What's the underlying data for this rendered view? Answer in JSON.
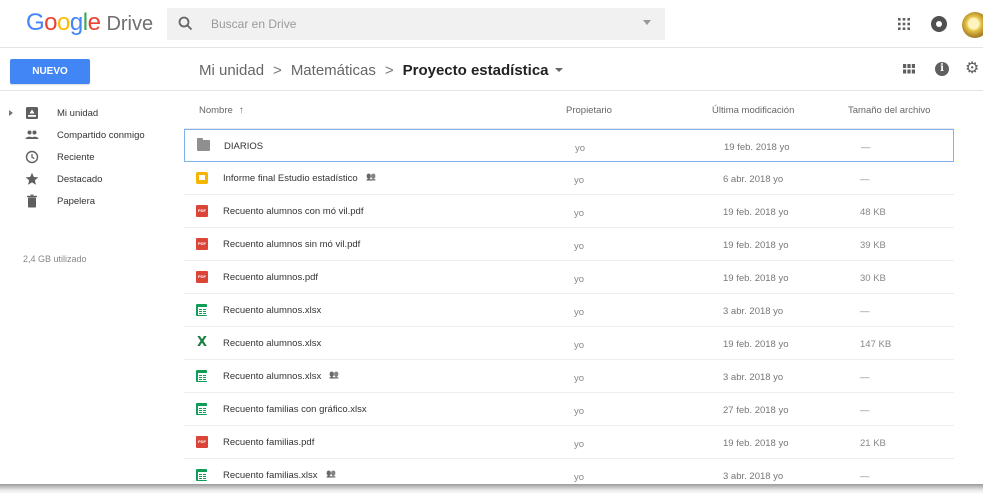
{
  "app": {
    "logo_google": "Google",
    "logo_drive": "Drive",
    "logo_colors": [
      "#4285F4",
      "#EA4335",
      "#FBBC05",
      "#4285F4",
      "#34A853",
      "#EA4335"
    ]
  },
  "search": {
    "placeholder": "Buscar en Drive",
    "value": ""
  },
  "toolbar": {
    "new_label": "NUEVO",
    "accent": "#4285f4"
  },
  "breadcrumb": {
    "items": [
      "Mi unidad",
      "Matemáticas"
    ],
    "separator": ">",
    "current": "Proyecto estadística"
  },
  "sidebar": {
    "items": [
      {
        "label": "Mi unidad",
        "icon": "drive-icon"
      },
      {
        "label": "Compartido conmigo",
        "icon": "people-icon"
      },
      {
        "label": "Reciente",
        "icon": "clock-icon"
      },
      {
        "label": "Destacado",
        "icon": "star-icon"
      },
      {
        "label": "Papelera",
        "icon": "trash-icon"
      }
    ],
    "storage": "2,4 GB utilizado"
  },
  "list": {
    "headers": {
      "name": "Nombre",
      "sort_arrow": "↑",
      "owner": "Propietario",
      "modified": "Última modificación",
      "size": "Tamaño del archivo"
    },
    "rows": [
      {
        "type": "folder",
        "name": "DIARIOS",
        "shared": false,
        "owner": "yo",
        "modified": "19 feb. 2018 yo",
        "size": "—"
      },
      {
        "type": "slides",
        "name": "Informe final Estudio estadístico",
        "shared": true,
        "owner": "yo",
        "modified": "6 abr. 2018 yo",
        "size": "—"
      },
      {
        "type": "pdf",
        "name": "Recuento alumnos con mó vil.pdf",
        "shared": false,
        "owner": "yo",
        "modified": "19 feb. 2018 yo",
        "size": "48 KB"
      },
      {
        "type": "pdf",
        "name": "Recuento alumnos sin mó vil.pdf",
        "shared": false,
        "owner": "yo",
        "modified": "19 feb. 2018 yo",
        "size": "39 KB"
      },
      {
        "type": "pdf",
        "name": "Recuento alumnos.pdf",
        "shared": false,
        "owner": "yo",
        "modified": "19 feb. 2018 yo",
        "size": "30 KB"
      },
      {
        "type": "sheets",
        "name": "Recuento alumnos.xlsx",
        "shared": false,
        "owner": "yo",
        "modified": "3 abr. 2018 yo",
        "size": "—"
      },
      {
        "type": "excel",
        "name": "Recuento alumnos.xlsx",
        "shared": false,
        "owner": "yo",
        "modified": "19 feb. 2018 yo",
        "size": "147 KB"
      },
      {
        "type": "sheets",
        "name": "Recuento alumnos.xlsx",
        "shared": true,
        "owner": "yo",
        "modified": "3 abr. 2018 yo",
        "size": "—"
      },
      {
        "type": "sheets",
        "name": "Recuento familias con gráfico.xlsx",
        "shared": false,
        "owner": "yo",
        "modified": "27 feb. 2018 yo",
        "size": "—"
      },
      {
        "type": "pdf",
        "name": "Recuento familias.pdf",
        "shared": false,
        "owner": "yo",
        "modified": "19 feb. 2018 yo",
        "size": "21 KB"
      },
      {
        "type": "sheets",
        "name": "Recuento familias.xlsx",
        "shared": true,
        "owner": "yo",
        "modified": "3 abr. 2018 yo",
        "size": "—"
      }
    ]
  }
}
